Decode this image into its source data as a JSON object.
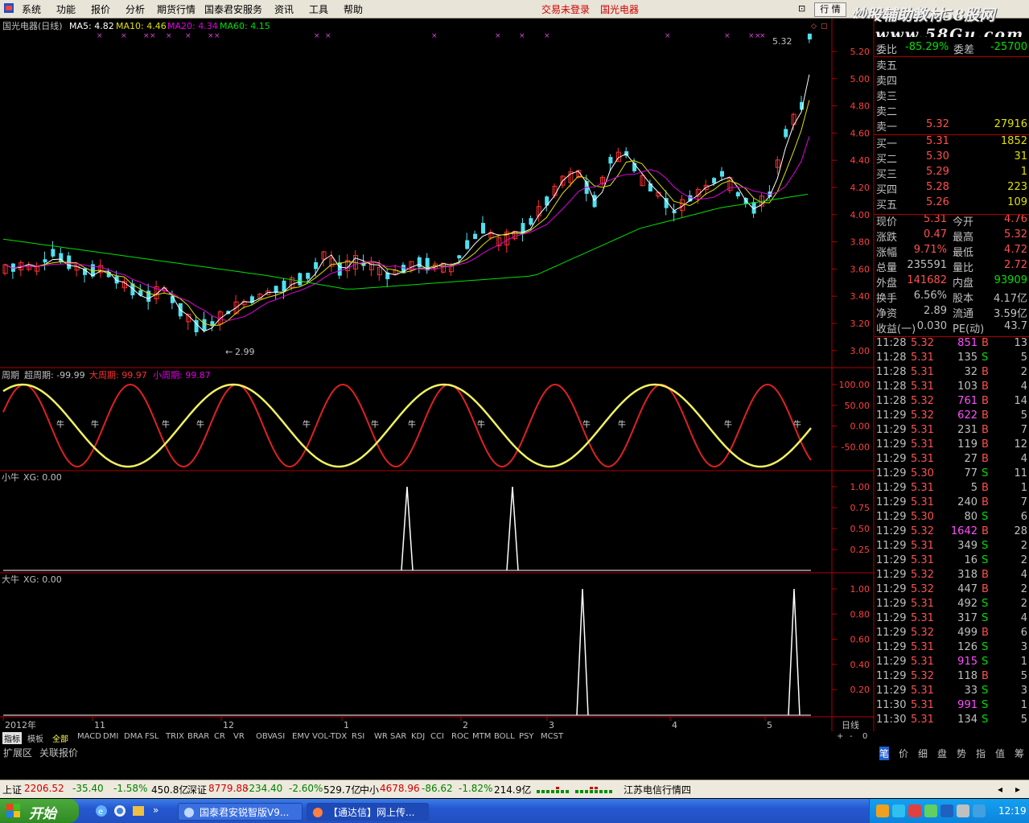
{
  "menu": {
    "items": [
      "系统",
      "功能",
      "报价",
      "分析",
      "期货行情",
      "国泰君安服务",
      "资讯",
      "工具",
      "帮助"
    ],
    "status_login": "交易未登录",
    "stock_name_red": "国光电器",
    "trade_button": "行 情",
    "watermark_top": "炒股辅助教材58股网",
    "watermark_url": "www.58Gu.com"
  },
  "main_chart": {
    "header_name": "国光电器(日线)",
    "ma5": "MA5: 4.82",
    "ma10": "MA10: 4.46",
    "ma20": "MA20: 4.34",
    "ma60": "MA60: 4.15",
    "high_label": "5.32",
    "low_label": "2.99",
    "y_ticks": [
      "5.20",
      "5.00",
      "4.80",
      "4.60",
      "4.40",
      "4.20",
      "4.00",
      "3.80",
      "3.60",
      "3.40",
      "3.20",
      "3.00"
    ],
    "colors": {
      "ma5": "#ffffff",
      "ma10": "#e0e000",
      "ma20": "#e000e0",
      "ma60": "#00e000",
      "up": "#ff3030",
      "down": "#50e0f0"
    }
  },
  "cycle_panel": {
    "title": "周期",
    "super": "超周期: -99.99",
    "big": "大周期: 99.97",
    "small": "小周期: 99.87",
    "marker_char": "牛",
    "y_ticks": [
      "100.00",
      "50.00",
      "0.00",
      "-50.00"
    ]
  },
  "small_bull_panel": {
    "title": "小牛",
    "xg": "XG: 0.00",
    "y_ticks": [
      "1.00",
      "0.75",
      "0.50",
      "0.25"
    ]
  },
  "big_bull_panel": {
    "title": "大牛",
    "xg": "XG: 0.00",
    "y_ticks": [
      "1.00",
      "0.80",
      "0.60",
      "0.40",
      "0.20"
    ]
  },
  "x_axis": {
    "labels": [
      "2012年",
      "11",
      "12",
      "1",
      "2",
      "3",
      "4",
      "5"
    ],
    "period": "日线"
  },
  "indicator_tabs": [
    "指标",
    "模板",
    "全部",
    "MACD",
    "DMI",
    "DMA",
    "FSL",
    "TRIX",
    "BRAR",
    "CR",
    "VR",
    "OBV",
    "ASI",
    "EMV",
    "VOL-TDX",
    "RSI",
    "WR",
    "SAR",
    "KDJ",
    "CCI",
    "ROC",
    "MTM",
    "BOLL",
    "PSY",
    "MCST"
  ],
  "tab_controls": [
    "+",
    "-",
    "0"
  ],
  "ext_bar": [
    "扩展区",
    "关联报价"
  ],
  "quote": {
    "top_partial": {
      "label1": "委比",
      "val1": "-85.29%",
      "label2": "委差",
      "val2": "-25700"
    },
    "sell": [
      {
        "label": "卖五",
        "price": "",
        "vol": ""
      },
      {
        "label": "卖四",
        "price": "",
        "vol": ""
      },
      {
        "label": "卖三",
        "price": "",
        "vol": ""
      },
      {
        "label": "卖二",
        "price": "",
        "vol": ""
      },
      {
        "label": "卖一",
        "price": "5.32",
        "vol": "27916"
      }
    ],
    "buy": [
      {
        "label": "买一",
        "price": "5.31",
        "vol": "1852"
      },
      {
        "label": "买二",
        "price": "5.30",
        "vol": "31"
      },
      {
        "label": "买三",
        "price": "5.29",
        "vol": "1"
      },
      {
        "label": "买四",
        "price": "5.28",
        "vol": "223"
      },
      {
        "label": "买五",
        "price": "5.26",
        "vol": "109"
      }
    ],
    "stats": [
      {
        "l1": "现价",
        "v1": "5.31",
        "c1": "rd",
        "l2": "今开",
        "v2": "4.76",
        "c2": "rd"
      },
      {
        "l1": "涨跌",
        "v1": "0.47",
        "c1": "rd",
        "l2": "最高",
        "v2": "5.32",
        "c2": "rd"
      },
      {
        "l1": "涨幅",
        "v1": "9.71%",
        "c1": "rd",
        "l2": "最低",
        "v2": "4.72",
        "c2": "rd"
      },
      {
        "l1": "总量",
        "v1": "235591",
        "c1": "w",
        "l2": "量比",
        "v2": "2.72",
        "c2": "rd"
      },
      {
        "l1": "外盘",
        "v1": "141682",
        "c1": "rd",
        "l2": "内盘",
        "v2": "93909",
        "c2": "gr"
      },
      {
        "l1": "换手",
        "v1": "6.56%",
        "c1": "w",
        "l2": "股本",
        "v2": "4.17亿",
        "c2": "w"
      },
      {
        "l1": "净资",
        "v1": "2.89",
        "c1": "w",
        "l2": "流通",
        "v2": "3.59亿",
        "c2": "w"
      },
      {
        "l1": "收益(一)",
        "v1": "0.030",
        "c1": "w",
        "l2": "PE(动)",
        "v2": "43.7",
        "c2": "w"
      }
    ],
    "ticks": [
      {
        "t": "11:28",
        "p": "5.32",
        "v": "851",
        "vc": "pk",
        "s": "B",
        "n": "13"
      },
      {
        "t": "11:28",
        "p": "5.31",
        "v": "135",
        "vc": "w",
        "s": "S",
        "n": "5"
      },
      {
        "t": "11:28",
        "p": "5.31",
        "v": "32",
        "vc": "w",
        "s": "B",
        "n": "2"
      },
      {
        "t": "11:28",
        "p": "5.31",
        "v": "103",
        "vc": "w",
        "s": "B",
        "n": "4"
      },
      {
        "t": "11:28",
        "p": "5.32",
        "v": "761",
        "vc": "pk",
        "s": "B",
        "n": "14"
      },
      {
        "t": "11:29",
        "p": "5.32",
        "v": "622",
        "vc": "pk",
        "s": "B",
        "n": "5"
      },
      {
        "t": "11:29",
        "p": "5.31",
        "v": "231",
        "vc": "w",
        "s": "B",
        "n": "7"
      },
      {
        "t": "11:29",
        "p": "5.31",
        "v": "119",
        "vc": "w",
        "s": "B",
        "n": "12"
      },
      {
        "t": "11:29",
        "p": "5.31",
        "v": "27",
        "vc": "w",
        "s": "B",
        "n": "4"
      },
      {
        "t": "11:29",
        "p": "5.30",
        "v": "77",
        "vc": "w",
        "s": "S",
        "n": "11"
      },
      {
        "t": "11:29",
        "p": "5.31",
        "v": "5",
        "vc": "w",
        "s": "B",
        "n": "1"
      },
      {
        "t": "11:29",
        "p": "5.31",
        "v": "240",
        "vc": "w",
        "s": "B",
        "n": "7"
      },
      {
        "t": "11:29",
        "p": "5.30",
        "v": "80",
        "vc": "w",
        "s": "S",
        "n": "6"
      },
      {
        "t": "11:29",
        "p": "5.32",
        "v": "1642",
        "vc": "pk",
        "s": "B",
        "n": "28"
      },
      {
        "t": "11:29",
        "p": "5.31",
        "v": "349",
        "vc": "w",
        "s": "S",
        "n": "2"
      },
      {
        "t": "11:29",
        "p": "5.31",
        "v": "16",
        "vc": "w",
        "s": "S",
        "n": "2"
      },
      {
        "t": "11:29",
        "p": "5.32",
        "v": "318",
        "vc": "w",
        "s": "B",
        "n": "4"
      },
      {
        "t": "11:29",
        "p": "5.32",
        "v": "447",
        "vc": "w",
        "s": "B",
        "n": "2"
      },
      {
        "t": "11:29",
        "p": "5.31",
        "v": "492",
        "vc": "w",
        "s": "S",
        "n": "2"
      },
      {
        "t": "11:29",
        "p": "5.31",
        "v": "317",
        "vc": "w",
        "s": "S",
        "n": "4"
      },
      {
        "t": "11:29",
        "p": "5.32",
        "v": "499",
        "vc": "w",
        "s": "B",
        "n": "6"
      },
      {
        "t": "11:29",
        "p": "5.31",
        "v": "126",
        "vc": "w",
        "s": "S",
        "n": "3"
      },
      {
        "t": "11:29",
        "p": "5.31",
        "v": "915",
        "vc": "pk",
        "s": "S",
        "n": "1"
      },
      {
        "t": "11:29",
        "p": "5.32",
        "v": "118",
        "vc": "w",
        "s": "B",
        "n": "5"
      },
      {
        "t": "11:29",
        "p": "5.31",
        "v": "33",
        "vc": "w",
        "s": "S",
        "n": "3"
      },
      {
        "t": "11:30",
        "p": "5.31",
        "v": "991",
        "vc": "pk",
        "s": "S",
        "n": "1"
      },
      {
        "t": "11:30",
        "p": "5.31",
        "v": "134",
        "vc": "w",
        "s": "S",
        "n": "5"
      }
    ],
    "bottom_tabs": [
      "笔",
      "价",
      "细",
      "盘",
      "势",
      "指",
      "值",
      "筹"
    ]
  },
  "status": {
    "sh_label": "上证",
    "sh_val": "2206.52",
    "sh_chg": "-35.40",
    "sh_pct": "-1.58%",
    "sh_amt": "450.8亿",
    "sz_label": "深证",
    "sz_val": "8779.88",
    "sz_chg": "-234.40",
    "sz_pct": "-2.60%",
    "sz_amt": "529.7亿",
    "zx_label": "中小",
    "zx_val": "4678.96",
    "zx_chg": "-86.62",
    "zx_pct": "-1.82%",
    "zx_amt": "214.9亿",
    "server": "江苏电信行情四"
  },
  "taskbar": {
    "start": "开始",
    "tasks": [
      "国泰君安锐智版V9...",
      "【通达信】网上传..."
    ],
    "clock": "12:19"
  }
}
